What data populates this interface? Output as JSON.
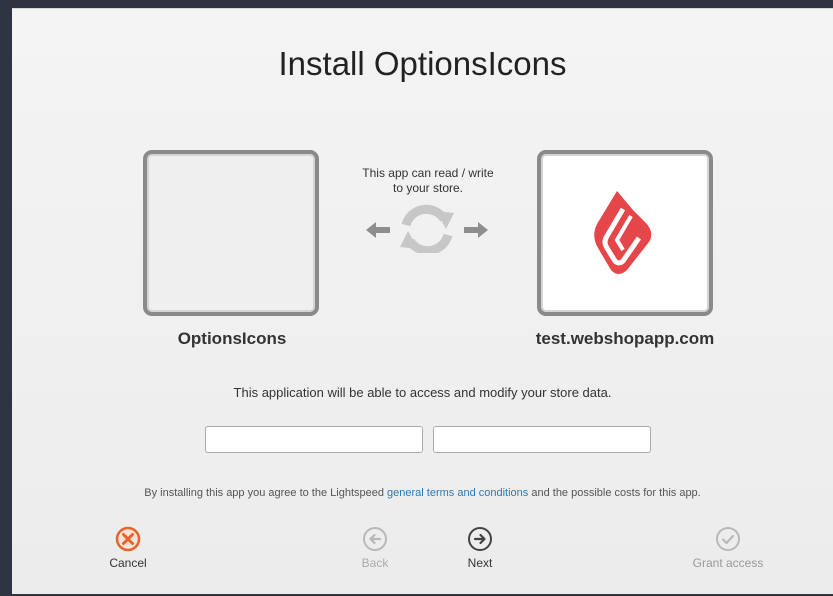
{
  "dialog": {
    "title": "Install OptionsIcons",
    "app_name": "OptionsIcons",
    "store_name": "test.webshopapp.com",
    "rw_line1": "This app can read / write",
    "rw_line2": "to your store.",
    "description": "This application will be able to access and modify your store data.",
    "field_a_value": "",
    "field_b_value": "",
    "terms_prefix": "By installing this app you agree to the Lightspeed ",
    "terms_link": "general terms and conditions",
    "terms_suffix": " and the possible costs for this app."
  },
  "actions": {
    "cancel": "Cancel",
    "back": "Back",
    "next": "Next",
    "grant": "Grant access"
  },
  "colors": {
    "cancel": "#e8622c",
    "brand": "#e4464a",
    "link": "#2a7ab8"
  },
  "icons": {
    "cancel": "close-circle-icon",
    "back": "arrow-left-circle-icon",
    "next": "arrow-right-circle-icon",
    "grant": "check-circle-icon",
    "sync": "sync-arrows-icon",
    "brand": "lightspeed-logo-icon"
  }
}
